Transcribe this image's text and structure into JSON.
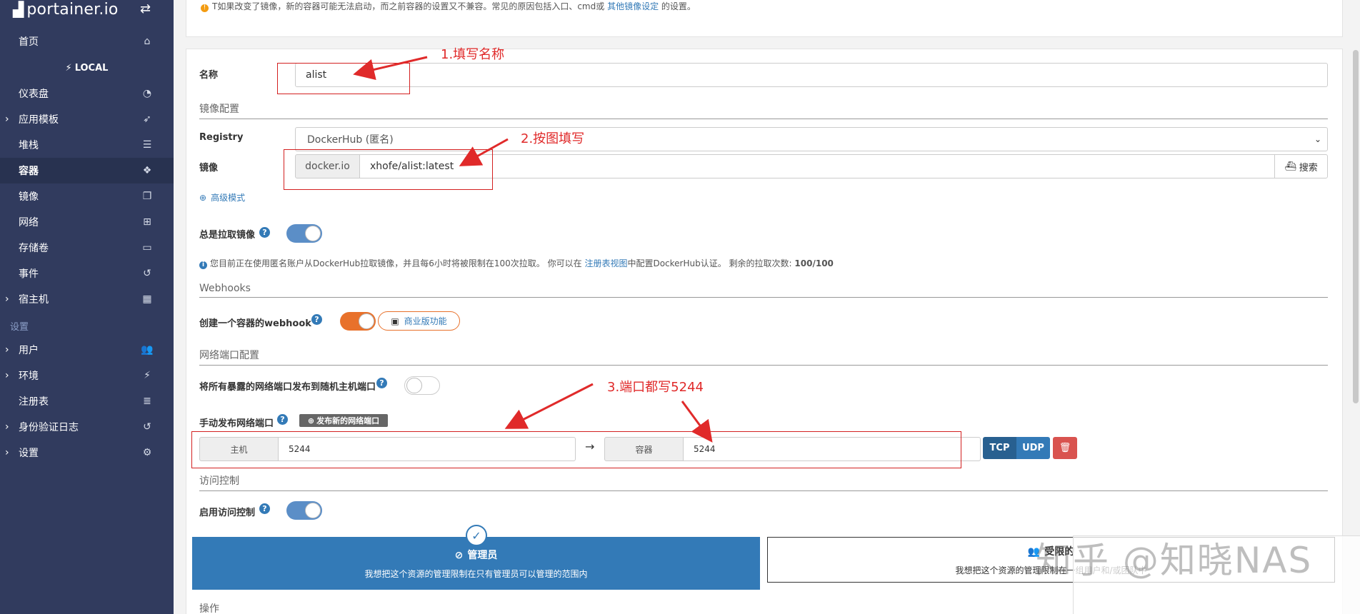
{
  "sidebar": {
    "brand": "portainer.io",
    "section_local": "LOCAL",
    "settings_heading": "设置",
    "items": [
      {
        "label": "首页",
        "icon": "home-icon",
        "glyph": "⌂"
      },
      {
        "label": "仪表盘",
        "icon": "dashboard-icon",
        "glyph": "◔"
      },
      {
        "label": "应用模板",
        "icon": "rocket-icon",
        "glyph": "➶"
      },
      {
        "label": "堆栈",
        "icon": "list-icon",
        "glyph": "☰"
      },
      {
        "label": "容器",
        "icon": "cubes-icon",
        "glyph": "❖"
      },
      {
        "label": "镜像",
        "icon": "clone-icon",
        "glyph": "❐"
      },
      {
        "label": "网络",
        "icon": "sitemap-icon",
        "glyph": "⊞"
      },
      {
        "label": "存储卷",
        "icon": "hdd-icon",
        "glyph": "▭"
      },
      {
        "label": "事件",
        "icon": "history-icon",
        "glyph": "↺"
      },
      {
        "label": "宿主机",
        "icon": "grid-icon",
        "glyph": "▦"
      },
      {
        "label": "用户",
        "icon": "users-icon",
        "glyph": "👥"
      },
      {
        "label": "环境",
        "icon": "plug-icon",
        "glyph": "⚡"
      },
      {
        "label": "注册表",
        "icon": "database-icon",
        "glyph": "≣"
      },
      {
        "label": "身份验证日志",
        "icon": "history-icon",
        "glyph": "↺"
      },
      {
        "label": "设置",
        "icon": "cogs-icon",
        "glyph": "⚙"
      }
    ]
  },
  "top_note": {
    "text": "T如果改变了镜像，新的容器可能无法启动，而之前容器的设置又不兼容。常见的原因包括入口、cmd或",
    "link": "其他镜像设定",
    "suffix": "的设置。"
  },
  "form": {
    "name_label": "名称",
    "name_value": "alist",
    "image_config_title": "镜像配置",
    "registry_label": "Registry",
    "registry_value": "DockerHub (匿名)",
    "image_label": "镜像",
    "image_prefix": "docker.io",
    "image_value": "xhofe/alist:latest",
    "search_button": "搜索",
    "advanced_mode": "高级模式",
    "always_pull_label": "总是拉取镜像",
    "always_pull": true,
    "pull_info": "您目前正在使用匿名账户从DockerHub拉取镜像，并且每6小时将被限制在100次拉取。 你可以在",
    "pull_info_link": "注册表视图",
    "pull_info_suffix": "中配置DockerHub认证。 剩余的拉取次数:",
    "pull_remaining": "100/100",
    "webhooks_title": "Webhooks",
    "webhook_label": "创建一个容器的webhook",
    "business_feature": "商业版功能",
    "network_title": "网络端口配置",
    "publish_all_label": "将所有暴露的网络端口发布到随机主机端口",
    "publish_all": false,
    "manual_publish_label": "手动发布网络端口",
    "publish_new_button": "发布新的网络端口",
    "host_label": "主机",
    "host_port": "5244",
    "container_label": "容器",
    "container_port": "5244",
    "tcp": "TCP",
    "udp": "UDP",
    "access_title": "访问控制",
    "access_label": "启用访问控制",
    "access_enabled": true,
    "admin_title": "管理员",
    "admin_desc": "我想把这个资源的管理限制在只有管理员可以管理的范围内",
    "restricted_title": "受限的",
    "restricted_desc": "我想把这个资源的管理限制在一组用户和/或团队中",
    "actions_title": "操作"
  },
  "annotations": {
    "step1": "1.填写名称",
    "step2": "2.按图填写",
    "step3": "3.端口都写5244"
  },
  "watermark": "知乎 @知晓NAS",
  "colors": {
    "sidebar": "#313b5e",
    "accent_blue": "#337ab7",
    "annotation_red": "#e02a2a",
    "toggle_orange": "#e8712b",
    "danger": "#d9534f"
  }
}
